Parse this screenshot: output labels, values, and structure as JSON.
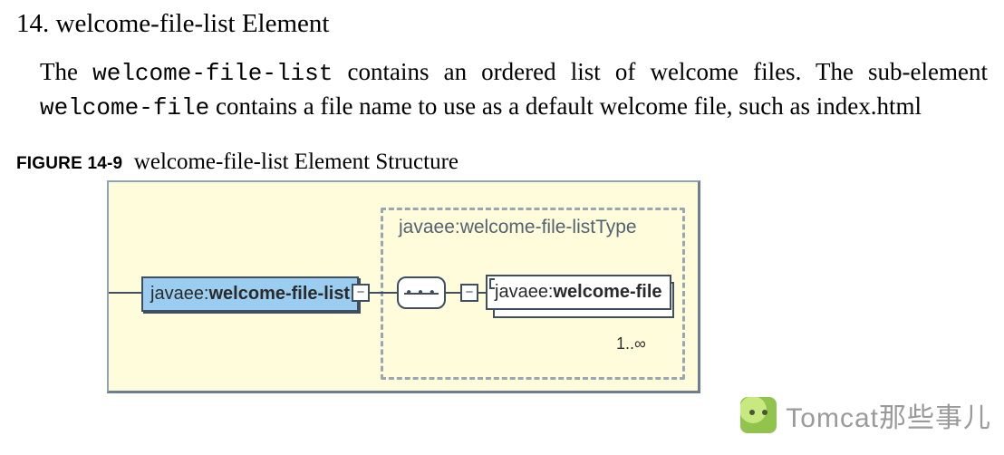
{
  "heading_number": "14.",
  "heading_text": "welcome-file-list Element",
  "paragraph": {
    "p1a": "The ",
    "code1": "welcome-file-list",
    "p1b": " contains an ordered list of welcome files. The sub-element ",
    "code2": "welcome-file",
    "p1c": " contains a file name to use as a default welcome file, such as index.html"
  },
  "figure": {
    "label": "FIGURE 14-9",
    "title": "welcome-file-list Element Structure"
  },
  "diagram": {
    "type_label": "javaee:welcome-file-listType",
    "left_ns": "javaee:",
    "left_name": "welcome-file-list",
    "right_ns": "javaee:",
    "right_name": "welcome-file",
    "cardinality": "1..∞",
    "handle_symbol": "−"
  },
  "watermark": {
    "text": "Tomcat那些事儿"
  }
}
